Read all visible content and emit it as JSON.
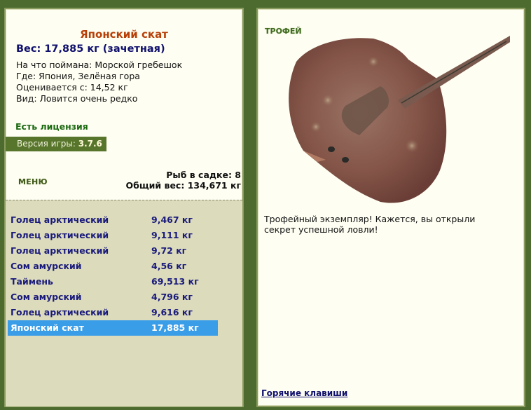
{
  "fish": {
    "name": "Японский скат",
    "weight": "Вес: 17,885 кг (зачетная)",
    "bait": "На что поймана: Морской гребешок",
    "place": "Где: Япония, Зелёная гора",
    "min_weight": "Оценивается с: 14,52 кг",
    "rarity": "Вид: Ловится очень редко"
  },
  "license": "Есть лицензия",
  "version": {
    "label": "Версия игры:",
    "value": "3.7.6"
  },
  "menu_label": "МЕНЮ",
  "keepnet": {
    "count_text": "Рыб в садке: 8",
    "total_text": "Общий вес: 134,671 кг"
  },
  "catch_list": [
    {
      "name": "Голец арктический",
      "weight": "9,467 кг"
    },
    {
      "name": "Голец арктический",
      "weight": "9,111 кг"
    },
    {
      "name": "Голец арктический",
      "weight": "9,72 кг"
    },
    {
      "name": "Сом амурский",
      "weight": "4,56 кг"
    },
    {
      "name": "Таймень",
      "weight": "69,513 кг"
    },
    {
      "name": "Сом амурский",
      "weight": "4,796 кг"
    },
    {
      "name": "Голец арктический",
      "weight": "9,616 кг"
    },
    {
      "name": "Японский скат",
      "weight": "17,885 кг"
    }
  ],
  "selected_index": 7,
  "trophy": {
    "title": "ТРОФЕЙ",
    "message": "Трофейный экземпляр! Кажется, вы открыли секрет успешной ловли!"
  },
  "hotkeys_link": "Горячие клавиши",
  "colors": {
    "background": "#4d6b2e",
    "panel": "#fefef2",
    "selected_row": "#3a9de8",
    "fish_name": "#b84008",
    "list_text": "#1a1a7c"
  }
}
